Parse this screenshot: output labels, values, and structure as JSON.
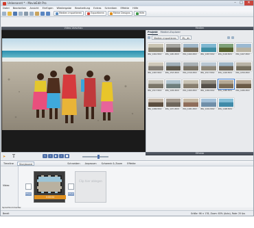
{
  "window": {
    "title": "Unbenannt * - MovieEdit Pro",
    "minimize": "–",
    "maximize": "□",
    "close": "✕"
  },
  "menu": [
    "Datei",
    "Bearbeiten",
    "Ansicht",
    "Einfügen",
    "Wiedergabe",
    "Bearbeitung",
    "Extras",
    "Schreiben",
    "Effekte",
    "Hilfe"
  ],
  "toolbar": {
    "import_label": "Medien importieren",
    "export_label": "Exportieren",
    "mine_label": "Meine Designs",
    "help_label": "Hilfe"
  },
  "video_panel": {
    "title": "Video-Vorschau"
  },
  "media_panel": {
    "title": "Medien",
    "tabs": [
      "Projekt",
      "Medien-Explorer"
    ],
    "path_label": "Medien importieren",
    "folder_label": "My_dir",
    "thumbnails": [
      {
        "name": "IMG_1461.MOV",
        "colors": [
          "#c9c4b2",
          "#8a8574"
        ]
      },
      {
        "name": "IMG_1481.MOV",
        "colors": [
          "#a5a5a0",
          "#636058"
        ]
      },
      {
        "name": "IMG_1460.MOV",
        "colors": [
          "#9eb6c8",
          "#77705f"
        ]
      },
      {
        "name": "IMG_1487.MOV",
        "colors": [
          "#7fb7d1",
          "#3f8ea3"
        ]
      },
      {
        "name": "IMG_2148.MOV",
        "colors": [
          "#7fa27a",
          "#55612e"
        ]
      },
      {
        "name": "IMG_1467.MOV",
        "colors": [
          "#9bb9d1",
          "#b8b2a1"
        ]
      },
      {
        "name": "IMG_1467.MOV",
        "colors": [
          "#cfc8b9",
          "#878178"
        ]
      },
      {
        "name": "IMG_1515.MOV",
        "colors": [
          "#a2b0b9",
          "#5f5a4e"
        ]
      },
      {
        "name": "IMG_1516.MOV",
        "colors": [
          "#a9b1b5",
          "#7a7467"
        ]
      },
      {
        "name": "IMG_1517.MOV",
        "colors": [
          "#b9c7d2",
          "#8e8879"
        ]
      },
      {
        "name": "IMG_1418.MOV",
        "colors": [
          "#9fb6c6",
          "#6b6456"
        ]
      },
      {
        "name": "IMG_1456.MOV",
        "colors": [
          "#b8b3a6",
          "#77705f"
        ]
      },
      {
        "name": "IMG_1517.MOV",
        "colors": [
          "#c6c3b8",
          "#7b7669"
        ]
      },
      {
        "name": "IMG_1430.MOV",
        "colors": [
          "#b0c4cf",
          "#6f7f7e"
        ]
      },
      {
        "name": "IMG_1469.MOV",
        "colors": [
          "#c8c2b3",
          "#887f6f"
        ]
      },
      {
        "name": "IMG_1484.MOV",
        "colors": [
          "#8e8a80",
          "#55504a"
        ]
      },
      {
        "name": "IMG_1485.MOV",
        "colors": [
          "#b5a996",
          "#7a6b57"
        ]
      },
      {
        "name": "IMG_1486.MOV",
        "colors": [
          "#b7aa98",
          "#6b5b47"
        ]
      },
      {
        "name": "IMG_1486.MOV",
        "colors": [
          "#c4b7a8",
          "#5b4d3e"
        ]
      },
      {
        "name": "IMG_1471.MOV",
        "colors": [
          "#a59c91",
          "#6d655b"
        ]
      },
      {
        "name": "IMG_1481.MOV",
        "colors": [
          "#c7bba8",
          "#8e6d5a"
        ]
      },
      {
        "name": "IMG_1491.MOV",
        "colors": [
          "#a5c2da",
          "#6f8ea8"
        ]
      },
      {
        "name": "IMG_1498.MOV",
        "colors": [
          "#86bfd8",
          "#3f8aa8"
        ]
      }
    ]
  },
  "lower_right": {
    "title": "Effekte"
  },
  "timeline_tabs": {
    "timeline": "Timeline",
    "storyboard": "Storyboard",
    "effects_a": "Schneiden",
    "effects_b": "Anpassen",
    "effects_c": "Schwenk & Zoom",
    "effects_d": "Effekte"
  },
  "storyboard": {
    "track_label": "Video",
    "placeholder_text": "Clip hier ablegen",
    "clip_duration": "0:00:04",
    "fx_label": "Effekt",
    "comment_label": "Sprachkommentar"
  },
  "status": {
    "left": "Bereit",
    "right": "Größe: 98 × 178, Zoom: 83% (Auto), Rate: 25 fps"
  }
}
